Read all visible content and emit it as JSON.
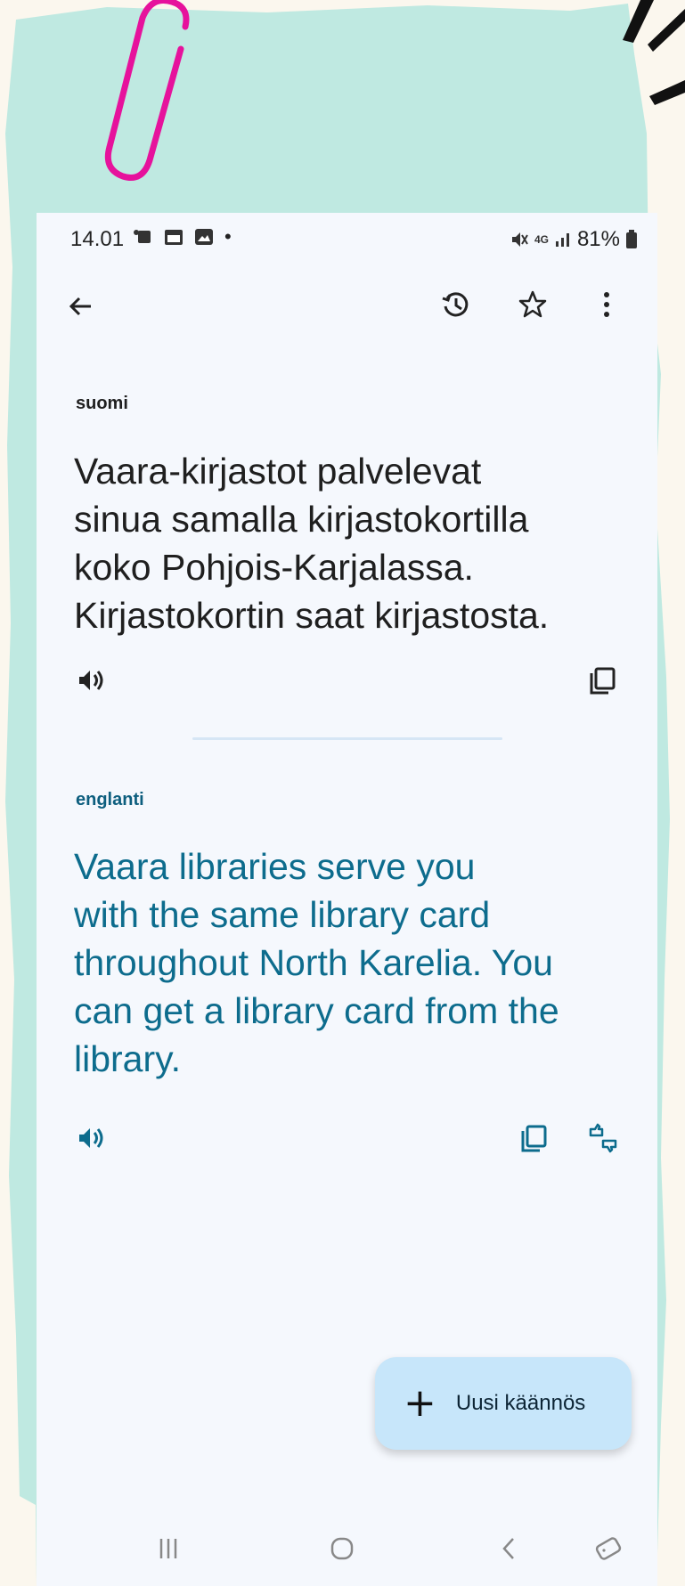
{
  "colors": {
    "mint": "#bfe9e1",
    "paper": "#fbf7ee",
    "screen": "#f5f8fd",
    "accent": "#0d6c8d",
    "fab": "#c7e6fa",
    "clip": "#e6129c"
  },
  "status_bar": {
    "time": "14.01",
    "notification_icons": [
      "teams-icon",
      "calendar-icon",
      "gallery-icon"
    ],
    "dot": "•",
    "network": "4G",
    "battery": "81%"
  },
  "app_bar": {
    "icons": [
      "back-arrow-icon",
      "history-icon",
      "star-icon",
      "more-vert-icon"
    ]
  },
  "source": {
    "language": "suomi",
    "text": "Vaara-kirjastot palvelevat\nsinua samalla kirjastokortilla\nkoko Pohjois-Karjalassa.\nKirjastokortin saat kirjastosta.",
    "actions": [
      "speaker-icon",
      "copy-icon"
    ]
  },
  "target": {
    "language": "englanti",
    "text": "Vaara libraries serve you\nwith the same library card\nthroughout North Karelia.  You\ncan get a library card from the\nlibrary.",
    "actions": [
      "speaker-icon",
      "copy-icon",
      "feedback-icon"
    ]
  },
  "fab": {
    "icon": "plus-icon",
    "label": "Uusi käännös"
  },
  "nav_bar": {
    "items": [
      "recent-apps-icon",
      "home-icon",
      "back-icon",
      "rotate-icon"
    ]
  }
}
